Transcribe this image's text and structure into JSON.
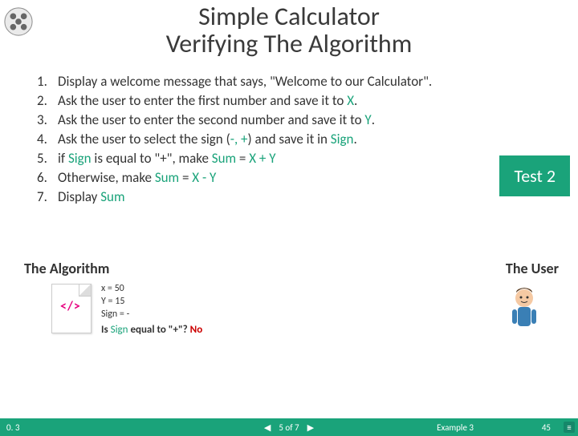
{
  "title": {
    "line1": "Simple Calculator",
    "line2": "Verifying The Algorithm"
  },
  "steps": [
    {
      "n": "1.",
      "pre": "Display a welcome message that says, \"Welcome to our Calculator\"."
    },
    {
      "n": "2.",
      "pre": "Ask the user to enter the first number and save it to ",
      "kw": "X",
      "post": "."
    },
    {
      "n": "3.",
      "pre": "Ask the user to enter the second number and save it to ",
      "kw": "Y",
      "post": "."
    },
    {
      "n": "4.",
      "pre": "Ask the user to select the sign (",
      "mid": "-, +",
      "post2": ") and save it in ",
      "kw": "Sign",
      "post": "."
    },
    {
      "n": "5.",
      "pre": "if ",
      "kw0": "Sign",
      "post0": " is equal to \"+\", make ",
      "kw": "Sum",
      "post1": " = ",
      "kw2": "X + Y"
    },
    {
      "n": "6.",
      "pre": "Otherwise, make ",
      "kw": "Sum",
      "post1": " = ",
      "kw2": "X - Y"
    },
    {
      "n": "7.",
      "pre": "Display ",
      "kw": "Sum"
    }
  ],
  "badge": "Test 2",
  "section_labels": {
    "left": "The Algorithm",
    "right": "The User"
  },
  "output": {
    "l1": "x = 50",
    "l2": "Y = 15",
    "l3": "Sign = -",
    "q_pre": "Is ",
    "q_kw": "Sign",
    "q_post": " equal to \"+\"? ",
    "ans": "No"
  },
  "paper_icon": "</>",
  "footer": {
    "version": "0. 3",
    "prev": "◀",
    "counter": "5 of 7",
    "next": "▶",
    "example": "Example 3",
    "page": "45",
    "menu": "≡"
  }
}
